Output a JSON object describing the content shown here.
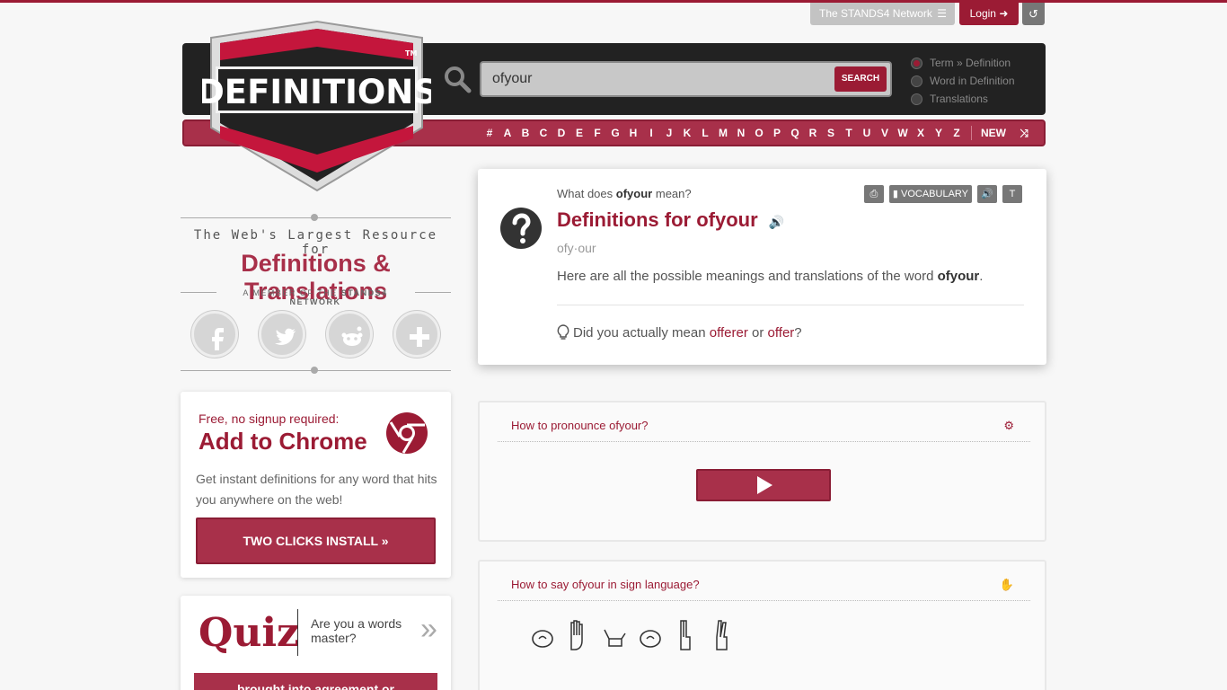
{
  "topbar": {
    "network_label": "The STANDS4 Network",
    "login_label": "Login"
  },
  "search": {
    "value": "ofyour",
    "button_label": "SEARCH",
    "options": [
      "Term » Definition",
      "Word in Definition",
      "Translations"
    ],
    "selected_option": "Term » Definition"
  },
  "alphabet": {
    "letters": [
      "#",
      "A",
      "B",
      "C",
      "D",
      "E",
      "F",
      "G",
      "H",
      "I",
      "J",
      "K",
      "L",
      "M",
      "N",
      "O",
      "P",
      "Q",
      "R",
      "S",
      "T",
      "U",
      "V",
      "W",
      "X",
      "Y",
      "Z"
    ],
    "new_label": "NEW"
  },
  "logo": {
    "text": "DEFINITIONS",
    "tm": "TM"
  },
  "tagline": {
    "line1": "The Web's Largest Resource for",
    "line2": "Definitions & Translations",
    "line3_prefix": "A MEMBER OF THE",
    "line3_network": "STANDS4 NETWORK"
  },
  "social": [
    "facebook-icon",
    "twitter-icon",
    "reddit-icon",
    "plus-icon"
  ],
  "chrome": {
    "free_label": "Free, no signup required:",
    "title": "Add to Chrome",
    "description": "Get instant definitions for any word that hits you anywhere on the web!",
    "button_label": "TWO CLICKS INSTALL »"
  },
  "quiz": {
    "title": "Quiz",
    "question": "Are you a words master?",
    "arrow": "»",
    "answer": "brought into agreement or"
  },
  "definition": {
    "what_prefix": "What does",
    "word": "ofyour",
    "what_suffix": "mean?",
    "tools": {
      "vocabulary_label": "VOCABULARY"
    },
    "title": "Definitions for ofyour",
    "phonetic": "ofy·our",
    "desc_prefix": "Here are all the possible meanings and translations of the word",
    "desc_word": "ofyour",
    "desc_suffix": ".",
    "didyou_prefix": "Did you actually mean",
    "suggestion1": "offerer",
    "or_word": "or",
    "suggestion2": "offer",
    "didyou_suffix": "?"
  },
  "pronounce": {
    "title": "How to pronounce ofyour?"
  },
  "sign": {
    "title": "How to say ofyour in sign language?"
  },
  "colors": {
    "brand": "#9b1b34",
    "brand_light": "#a8304a",
    "header_dark": "#222222"
  }
}
